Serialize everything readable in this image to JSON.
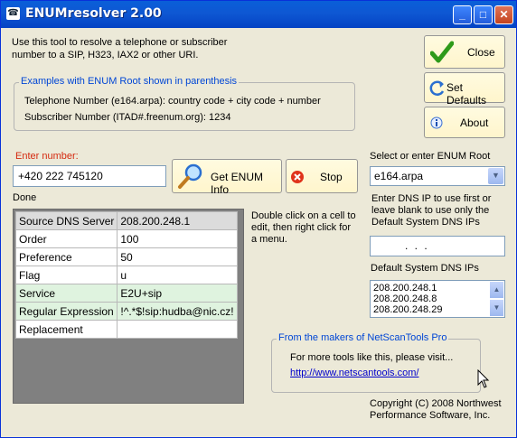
{
  "window": {
    "title": "ENUMresolver 2.00"
  },
  "intro": "Use this tool to resolve a telephone or subscriber number to a SIP, H323, IAX2 or other URI.",
  "examples": {
    "title": "Examples with ENUM Root shown in parenthesis",
    "line1": "Telephone Number (e164.arpa): country code + city code + number",
    "line2": "Subscriber Number (ITAD#.freenum.org): 1234"
  },
  "buttons": {
    "close": "Close",
    "set_defaults": "Set Defaults",
    "about": "About",
    "get_enum": "Get ENUM Info",
    "stop": "Stop"
  },
  "enter_number": {
    "label": "Enter number:",
    "value": "+420 222 745120"
  },
  "status": "Done",
  "enum_root": {
    "label": "Select or enter ENUM Root",
    "value": "e164.arpa"
  },
  "dns": {
    "instruction": "Enter DNS IP to use first or leave blank to use only the Default System DNS IPs",
    "ip_placeholder": ".    .    .",
    "default_label": "Default System DNS IPs",
    "default_ips": [
      "208.200.248.1",
      "208.200.248.8",
      "208.200.248.29"
    ]
  },
  "hint": "Double click on a cell to edit, then right click for a menu.",
  "results": [
    {
      "field": "Source DNS Server",
      "value": "208.200.248.1"
    },
    {
      "field": "Order",
      "value": "100"
    },
    {
      "field": "Preference",
      "value": "50"
    },
    {
      "field": "Flag",
      "value": "u"
    },
    {
      "field": "Service",
      "value": "E2U+sip"
    },
    {
      "field": "Regular Expression",
      "value": "!^.*$!sip:hudba@nic.cz!"
    },
    {
      "field": "Replacement",
      "value": ""
    }
  ],
  "makers": {
    "title": "From the makers of NetScanTools Pro",
    "text": "For more tools like this, please visit...",
    "link": "http://www.netscantools.com/"
  },
  "copyright": "Copyright (C) 2008 Northwest Performance Software, Inc.",
  "colors": {
    "titlebar": "#0a5fd8",
    "accent_red": "#d42a10",
    "link": "#0000cc"
  }
}
